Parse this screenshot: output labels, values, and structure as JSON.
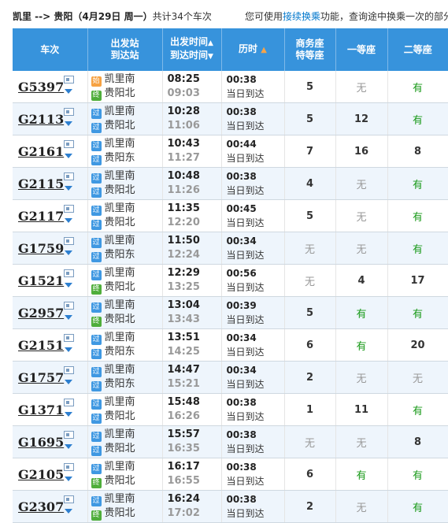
{
  "header": {
    "route_text": "凯里 --> 贵阳（4月29日 周一）",
    "count_text": "共计34个车次",
    "hint_prefix": "您可使用",
    "hint_link": "接续换乘",
    "hint_suffix": "功能，查询途中换乘一次的部分"
  },
  "columns": {
    "train": "车次",
    "station_1": "出发站",
    "station_2": "到达站",
    "time_1": "出发时间",
    "time_2": "到达时间",
    "duration": "历时",
    "business_1": "商务座",
    "business_2": "特等座",
    "first": "一等座",
    "second": "二等座"
  },
  "colors": {
    "header_bg": "#3793dc",
    "available_green": "#1a9a1a",
    "pass_badge": "#3f98e2",
    "start_badge": "#f6a243",
    "end_badge": "#4fae3b"
  },
  "trains": [
    {
      "no": "G5397",
      "from": "凯里南",
      "from_badge": "始",
      "to": "贵阳北",
      "to_badge": "终",
      "dep": "08:25",
      "arr": "09:03",
      "dur": "00:38",
      "arrive": "当日到达",
      "business": "5",
      "first": "无",
      "second": "有"
    },
    {
      "no": "G2113",
      "from": "凯里南",
      "from_badge": "过",
      "to": "贵阳北",
      "to_badge": "过",
      "dep": "10:28",
      "arr": "11:06",
      "dur": "00:38",
      "arrive": "当日到达",
      "business": "5",
      "first": "12",
      "second": "有"
    },
    {
      "no": "G2161",
      "from": "凯里南",
      "from_badge": "过",
      "to": "贵阳东",
      "to_badge": "过",
      "dep": "10:43",
      "arr": "11:27",
      "dur": "00:44",
      "arrive": "当日到达",
      "business": "7",
      "first": "16",
      "second": "8"
    },
    {
      "no": "G2115",
      "from": "凯里南",
      "from_badge": "过",
      "to": "贵阳北",
      "to_badge": "过",
      "dep": "10:48",
      "arr": "11:26",
      "dur": "00:38",
      "arrive": "当日到达",
      "business": "4",
      "first": "无",
      "second": "有"
    },
    {
      "no": "G2117",
      "from": "凯里南",
      "from_badge": "过",
      "to": "贵阳北",
      "to_badge": "过",
      "dep": "11:35",
      "arr": "12:20",
      "dur": "00:45",
      "arrive": "当日到达",
      "business": "5",
      "first": "无",
      "second": "有"
    },
    {
      "no": "G1759",
      "from": "凯里南",
      "from_badge": "过",
      "to": "贵阳东",
      "to_badge": "过",
      "dep": "11:50",
      "arr": "12:24",
      "dur": "00:34",
      "arrive": "当日到达",
      "business": "无",
      "first": "无",
      "second": "有"
    },
    {
      "no": "G1521",
      "from": "凯里南",
      "from_badge": "过",
      "to": "贵阳北",
      "to_badge": "终",
      "dep": "12:29",
      "arr": "13:25",
      "dur": "00:56",
      "arrive": "当日到达",
      "business": "无",
      "first": "4",
      "second": "17"
    },
    {
      "no": "G2957",
      "from": "凯里南",
      "from_badge": "过",
      "to": "贵阳北",
      "to_badge": "终",
      "dep": "13:04",
      "arr": "13:43",
      "dur": "00:39",
      "arrive": "当日到达",
      "business": "5",
      "first": "有",
      "second": "有"
    },
    {
      "no": "G2151",
      "from": "凯里南",
      "from_badge": "过",
      "to": "贵阳东",
      "to_badge": "过",
      "dep": "13:51",
      "arr": "14:25",
      "dur": "00:34",
      "arrive": "当日到达",
      "business": "6",
      "first": "有",
      "second": "20"
    },
    {
      "no": "G1757",
      "from": "凯里南",
      "from_badge": "过",
      "to": "贵阳东",
      "to_badge": "过",
      "dep": "14:47",
      "arr": "15:21",
      "dur": "00:34",
      "arrive": "当日到达",
      "business": "2",
      "first": "无",
      "second": "无"
    },
    {
      "no": "G1371",
      "from": "凯里南",
      "from_badge": "过",
      "to": "贵阳北",
      "to_badge": "过",
      "dep": "15:48",
      "arr": "16:26",
      "dur": "00:38",
      "arrive": "当日到达",
      "business": "1",
      "first": "11",
      "second": "有"
    },
    {
      "no": "G1695",
      "from": "凯里南",
      "from_badge": "过",
      "to": "贵阳北",
      "to_badge": "过",
      "dep": "15:57",
      "arr": "16:35",
      "dur": "00:38",
      "arrive": "当日到达",
      "business": "无",
      "first": "无",
      "second": "8"
    },
    {
      "no": "G2105",
      "from": "凯里南",
      "from_badge": "过",
      "to": "贵阳北",
      "to_badge": "终",
      "dep": "16:17",
      "arr": "16:55",
      "dur": "00:38",
      "arrive": "当日到达",
      "business": "6",
      "first": "有",
      "second": "有"
    },
    {
      "no": "G2307",
      "from": "凯里南",
      "from_badge": "过",
      "to": "贵阳北",
      "to_badge": "终",
      "dep": "16:24",
      "arr": "17:02",
      "dur": "00:38",
      "arrive": "当日到达",
      "business": "2",
      "first": "无",
      "second": "有"
    }
  ]
}
